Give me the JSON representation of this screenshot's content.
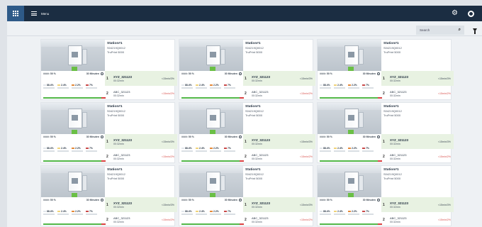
{
  "app": {
    "menu_label": "Menu"
  },
  "search": {
    "label": "Search"
  },
  "kpi_colors": [
    "#e3e7ec",
    "#f0d37a",
    "#e48a3a",
    "#c94a4a"
  ],
  "stations": [
    {
      "name": "Station#1",
      "serial": "S04219Q0012",
      "model": "TruPrint 5000",
      "left_stat": "####: 50 %",
      "time_label": "30 Minuten",
      "kpis": [
        "88.4%",
        "2.4%",
        "2.2%",
        "7%"
      ],
      "job1": {
        "pos": "1",
        "name": "XYZ_321123",
        "time": "00:32min",
        "rate": "<15min/3%"
      },
      "job2": {
        "pos": "2",
        "name": "ABC_321123",
        "time": "00:32min",
        "rate": "<15min/2%"
      }
    },
    {
      "name": "Station#1",
      "serial": "S04219Q0012",
      "model": "TruPrint 5000",
      "left_stat": "####: 50 %",
      "time_label": "30 Minuten",
      "kpis": [
        "88.4%",
        "2.4%",
        "2.2%",
        "7%"
      ],
      "job1": {
        "pos": "1",
        "name": "XYZ_321123",
        "time": "00:32min",
        "rate": "<15min/3%"
      },
      "job2": {
        "pos": "2",
        "name": "ABC_321123",
        "time": "00:32min",
        "rate": "<15min/2%"
      }
    },
    {
      "name": "Station#1",
      "serial": "S04219Q0012",
      "model": "TruPrint 5000",
      "left_stat": "####: 50 %",
      "time_label": "30 Minuten",
      "kpis": [
        "88.4%",
        "2.4%",
        "2.2%",
        "7%"
      ],
      "job1": {
        "pos": "1",
        "name": "XYZ_321123",
        "time": "00:32min",
        "rate": "<15min/3%"
      },
      "job2": {
        "pos": "2",
        "name": "ABC_321123",
        "time": "00:32min",
        "rate": "<15min/2%"
      }
    },
    {
      "name": "Station#1",
      "serial": "S04219Q0012",
      "model": "TruPrint 5000",
      "left_stat": "####: 50 %",
      "time_label": "30 Minuten",
      "kpis": [
        "88.4%",
        "2.4%",
        "2.2%",
        "7%"
      ],
      "job1": {
        "pos": "1",
        "name": "XYZ_321123",
        "time": "00:32min",
        "rate": "<15min/3%"
      },
      "job2": {
        "pos": "2",
        "name": "ABC_321123",
        "time": "00:32min",
        "rate": "<15min/2%"
      }
    },
    {
      "name": "Station#1",
      "serial": "S04219Q0012",
      "model": "TruPrint 5000",
      "left_stat": "####: 50 %",
      "time_label": "30 Minuten",
      "kpis": [
        "88.4%",
        "2.4%",
        "2.2%",
        "7%"
      ],
      "job1": {
        "pos": "1",
        "name": "XYZ_321123",
        "time": "00:32min",
        "rate": "<15min/3%"
      },
      "job2": {
        "pos": "2",
        "name": "ABC_321123",
        "time": "00:32min",
        "rate": "<15min/2%"
      }
    },
    {
      "name": "Station#1",
      "serial": "S04219Q0012",
      "model": "TruPrint 5000",
      "left_stat": "####: 50 %",
      "time_label": "30 Minuten",
      "kpis": [
        "88.4%",
        "2.4%",
        "2.2%",
        "7%"
      ],
      "job1": {
        "pos": "1",
        "name": "XYZ_321123",
        "time": "00:32min",
        "rate": "<15min/3%"
      },
      "job2": {
        "pos": "2",
        "name": "ABC_321123",
        "time": "00:32min",
        "rate": "<15min/2%"
      }
    },
    {
      "name": "Station#1",
      "serial": "S04219Q0012",
      "model": "TruPrint 5000",
      "left_stat": "####: 50 %",
      "time_label": "30 Minuten",
      "kpis": [
        "88.4%",
        "2.4%",
        "2.2%",
        "7%"
      ],
      "job1": {
        "pos": "1",
        "name": "XYZ_321123",
        "time": "00:32min",
        "rate": "<15min/3%"
      },
      "job2": {
        "pos": "2",
        "name": "ABC_321123",
        "time": "00:32min",
        "rate": "<15min/2%"
      }
    },
    {
      "name": "Station#1",
      "serial": "S04219Q0012",
      "model": "TruPrint 5000",
      "left_stat": "####: 50 %",
      "time_label": "30 Minuten",
      "kpis": [
        "88.4%",
        "2.4%",
        "2.2%",
        "7%"
      ],
      "job1": {
        "pos": "1",
        "name": "XYZ_321123",
        "time": "00:32min",
        "rate": "<15min/3%"
      },
      "job2": {
        "pos": "2",
        "name": "ABC_321123",
        "time": "00:32min",
        "rate": "<15min/2%"
      }
    },
    {
      "name": "Station#1",
      "serial": "S04219Q0012",
      "model": "TruPrint 5000",
      "left_stat": "####: 50 %",
      "time_label": "30 Minuten",
      "kpis": [
        "88.4%",
        "2.4%",
        "2.2%",
        "7%"
      ],
      "job1": {
        "pos": "1",
        "name": "XYZ_321123",
        "time": "00:32min",
        "rate": "<15min/3%"
      },
      "job2": {
        "pos": "2",
        "name": "ABC_321123",
        "time": "00:32min",
        "rate": "<15min/2%"
      }
    }
  ]
}
